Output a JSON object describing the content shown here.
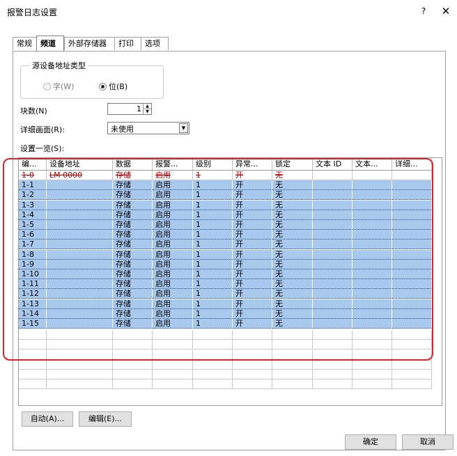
{
  "window": {
    "title": "报警日志设置",
    "help": "?",
    "close": "✕"
  },
  "tabs": [
    {
      "label": "常规"
    },
    {
      "label": "频道"
    },
    {
      "label": "外部存储器"
    },
    {
      "label": "打印"
    },
    {
      "label": "选项"
    }
  ],
  "address_type": {
    "title": "源设备地址类型",
    "word_label": "字(W)",
    "bit_label": "位(B)",
    "selected": "bit"
  },
  "blocks": {
    "label": "块数(N)",
    "value": "1"
  },
  "detail_screen": {
    "label": "详细画面(R):",
    "value": "未使用"
  },
  "list": {
    "label": "设置一览(S):",
    "headers": [
      "编...",
      "设备地址",
      "数据",
      "报警...",
      "级别",
      "异常...",
      "锁定",
      "文本 ID",
      "文本...",
      "详细..."
    ],
    "rows": [
      [
        "1-0",
        "LM 0000",
        "存储",
        "启用",
        "1",
        "开",
        "无",
        "",
        "",
        ""
      ],
      [
        "1-1",
        "",
        "存储",
        "启用",
        "1",
        "开",
        "无",
        "",
        "",
        ""
      ],
      [
        "1-2",
        "",
        "存储",
        "启用",
        "1",
        "开",
        "无",
        "",
        "",
        ""
      ],
      [
        "1-3",
        "",
        "存储",
        "启用",
        "1",
        "开",
        "无",
        "",
        "",
        ""
      ],
      [
        "1-4",
        "",
        "存储",
        "启用",
        "1",
        "开",
        "无",
        "",
        "",
        ""
      ],
      [
        "1-5",
        "",
        "存储",
        "启用",
        "1",
        "开",
        "无",
        "",
        "",
        ""
      ],
      [
        "1-6",
        "",
        "存储",
        "启用",
        "1",
        "开",
        "无",
        "",
        "",
        ""
      ],
      [
        "1-7",
        "",
        "存储",
        "启用",
        "1",
        "开",
        "无",
        "",
        "",
        ""
      ],
      [
        "1-8",
        "",
        "存储",
        "启用",
        "1",
        "开",
        "无",
        "",
        "",
        ""
      ],
      [
        "1-9",
        "",
        "存储",
        "启用",
        "1",
        "开",
        "无",
        "",
        "",
        ""
      ],
      [
        "1-10",
        "",
        "存储",
        "启用",
        "1",
        "开",
        "无",
        "",
        "",
        ""
      ],
      [
        "1-11",
        "",
        "存储",
        "启用",
        "1",
        "开",
        "无",
        "",
        "",
        ""
      ],
      [
        "1-12",
        "",
        "存储",
        "启用",
        "1",
        "开",
        "无",
        "",
        "",
        ""
      ],
      [
        "1-13",
        "",
        "存储",
        "启用",
        "1",
        "开",
        "无",
        "",
        "",
        ""
      ],
      [
        "1-14",
        "",
        "存储",
        "启用",
        "1",
        "开",
        "无",
        "",
        "",
        ""
      ],
      [
        "1-15",
        "",
        "存储",
        "启用",
        "1",
        "开",
        "无",
        "",
        "",
        ""
      ]
    ]
  },
  "buttons": {
    "auto": "自动(A)...",
    "edit": "编辑(E)...",
    "ok": "确定",
    "cancel": "取消"
  },
  "colors": {
    "selection": "#a8c8ee",
    "highlight_border": "#e0202a",
    "first_row_text": "#c00000"
  }
}
